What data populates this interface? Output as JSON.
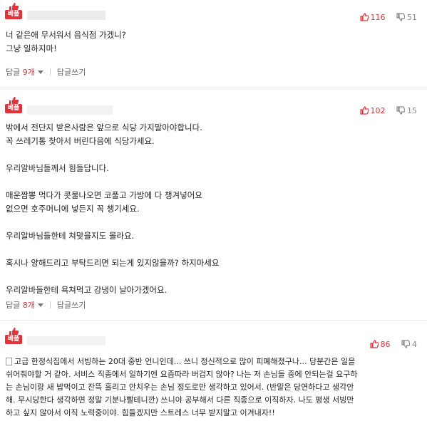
{
  "best_label": "베플",
  "comments": [
    {
      "up": "116",
      "down": "51",
      "lines": [
        "너 같은애 무서워서 음식점 가겠니?",
        "그냥 일하지마!"
      ],
      "reply_label": "답글",
      "reply_count": "9개",
      "write_reply": "답글쓰기"
    },
    {
      "up": "102",
      "down": "15",
      "lines": [
        "밖에서 전단지 받은사람은 앞으로 식당 가지말아야합니다.",
        "꼭 쓰레기통 찾아서 버린다음에 식당가세요.",
        "우리알바님들께서 힘들답니다.",
        "매운짬뽕 먹다가 콧물나오면 코풀고 가방에 다 챙겨넣어요",
        "없으면 호주머니에 넣든지 꼭 챙기세요.",
        "우리알바님들한테 쳐맞을지도 몰라요.",
        "혹시나 양해드리고 부탁드리면 되는게 있지않을까? 하지마세요",
        "우리알바들한테 욕쳐먹고 강냉이 날아가겠어요."
      ],
      "reply_label": "답글",
      "reply_count": "8개",
      "write_reply": "답글쓰기"
    },
    {
      "up": "86",
      "down": "4",
      "lines": [
        "고급 한정식집에서 서빙하는 20대 중반 언니인데... 쓰니 정신적으로 많이 피폐해졌구나... 당분간은 일을",
        "쉬어줘야할 거 같아. 서비스 직종에서 일하기엔 요즘따라 버겁지 않아? 나는 저 손님들 중에 안되는걸 요구하",
        "는 손님이랑 새 밥먹이고 잔뜩 흘리고 안치우는 손님 정도로만 생각하고 있어서. (반말은 당연하다고 생각안",
        "해. 무시당한다 생각하면 정말 기분나빨테니깐) 쓰니야 공부해서 다른 직종으로 이직하자. 나도 평생 서빙만",
        "하고 싶지 않아서 이직 노력중이야. 힘들겠지만 스트레스 너무 받지말고 이겨내자!!"
      ]
    }
  ],
  "colors": {
    "accent": "#e2333a",
    "muted": "#666666"
  },
  "icons": [
    "thumb-up-icon",
    "thumb-down-icon",
    "caret-down-icon",
    "document-icon"
  ]
}
